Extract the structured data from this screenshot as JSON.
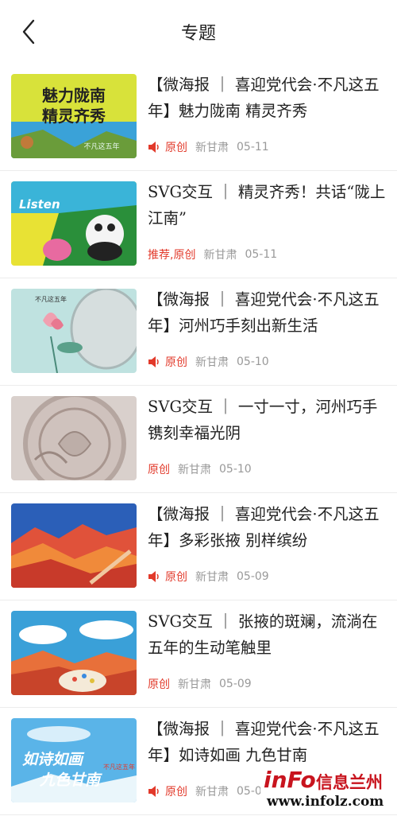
{
  "header": {
    "title": "专题"
  },
  "items": [
    {
      "title": "【微海报 ｜ 喜迎党代会·不凡这五年】魅力陇南 精灵齐秀",
      "tag": "原创",
      "source": "新甘肃",
      "date": "05-11",
      "audio": true,
      "thumb_text": [
        "魅力陇南",
        "精灵齐秀",
        "不凡这五年"
      ]
    },
    {
      "title": "SVG交互 ｜ 精灵齐秀！共话“陇上江南”",
      "tag": "推荐,原创",
      "source": "新甘肃",
      "date": "05-11",
      "audio": false,
      "thumb_text": [
        "Listen"
      ]
    },
    {
      "title": "【微海报 ｜ 喜迎党代会·不凡这五年】河州巧手刻出新生活",
      "tag": "原创",
      "source": "新甘肃",
      "date": "05-10",
      "audio": true,
      "thumb_text": [
        "不凡这五年"
      ]
    },
    {
      "title": "SVG交互 ｜ 一寸一寸，河州巧手镌刻幸福光阴",
      "tag": "原创",
      "source": "新甘肃",
      "date": "05-10",
      "audio": false,
      "thumb_text": []
    },
    {
      "title": "【微海报 ｜ 喜迎党代会·不凡这五年】多彩张掖 别样缤纷",
      "tag": "原创",
      "source": "新甘肃",
      "date": "05-09",
      "audio": true,
      "thumb_text": []
    },
    {
      "title": "SVG交互 ｜ 张掖的斑斓，流淌在五年的生动笔触里",
      "tag": "原创",
      "source": "新甘肃",
      "date": "05-09",
      "audio": false,
      "thumb_text": []
    },
    {
      "title": "【微海报 ｜ 喜迎党代会·不凡这五年】如诗如画 九色甘南",
      "tag": "原创",
      "source": "新甘肃",
      "date": "05-0",
      "audio": true,
      "thumb_text": [
        "如诗如画",
        "九色甘南",
        "不凡这五年"
      ]
    }
  ],
  "watermark": {
    "logo": "inFo",
    "name": "信息兰州",
    "url": "www.infolz.com"
  }
}
